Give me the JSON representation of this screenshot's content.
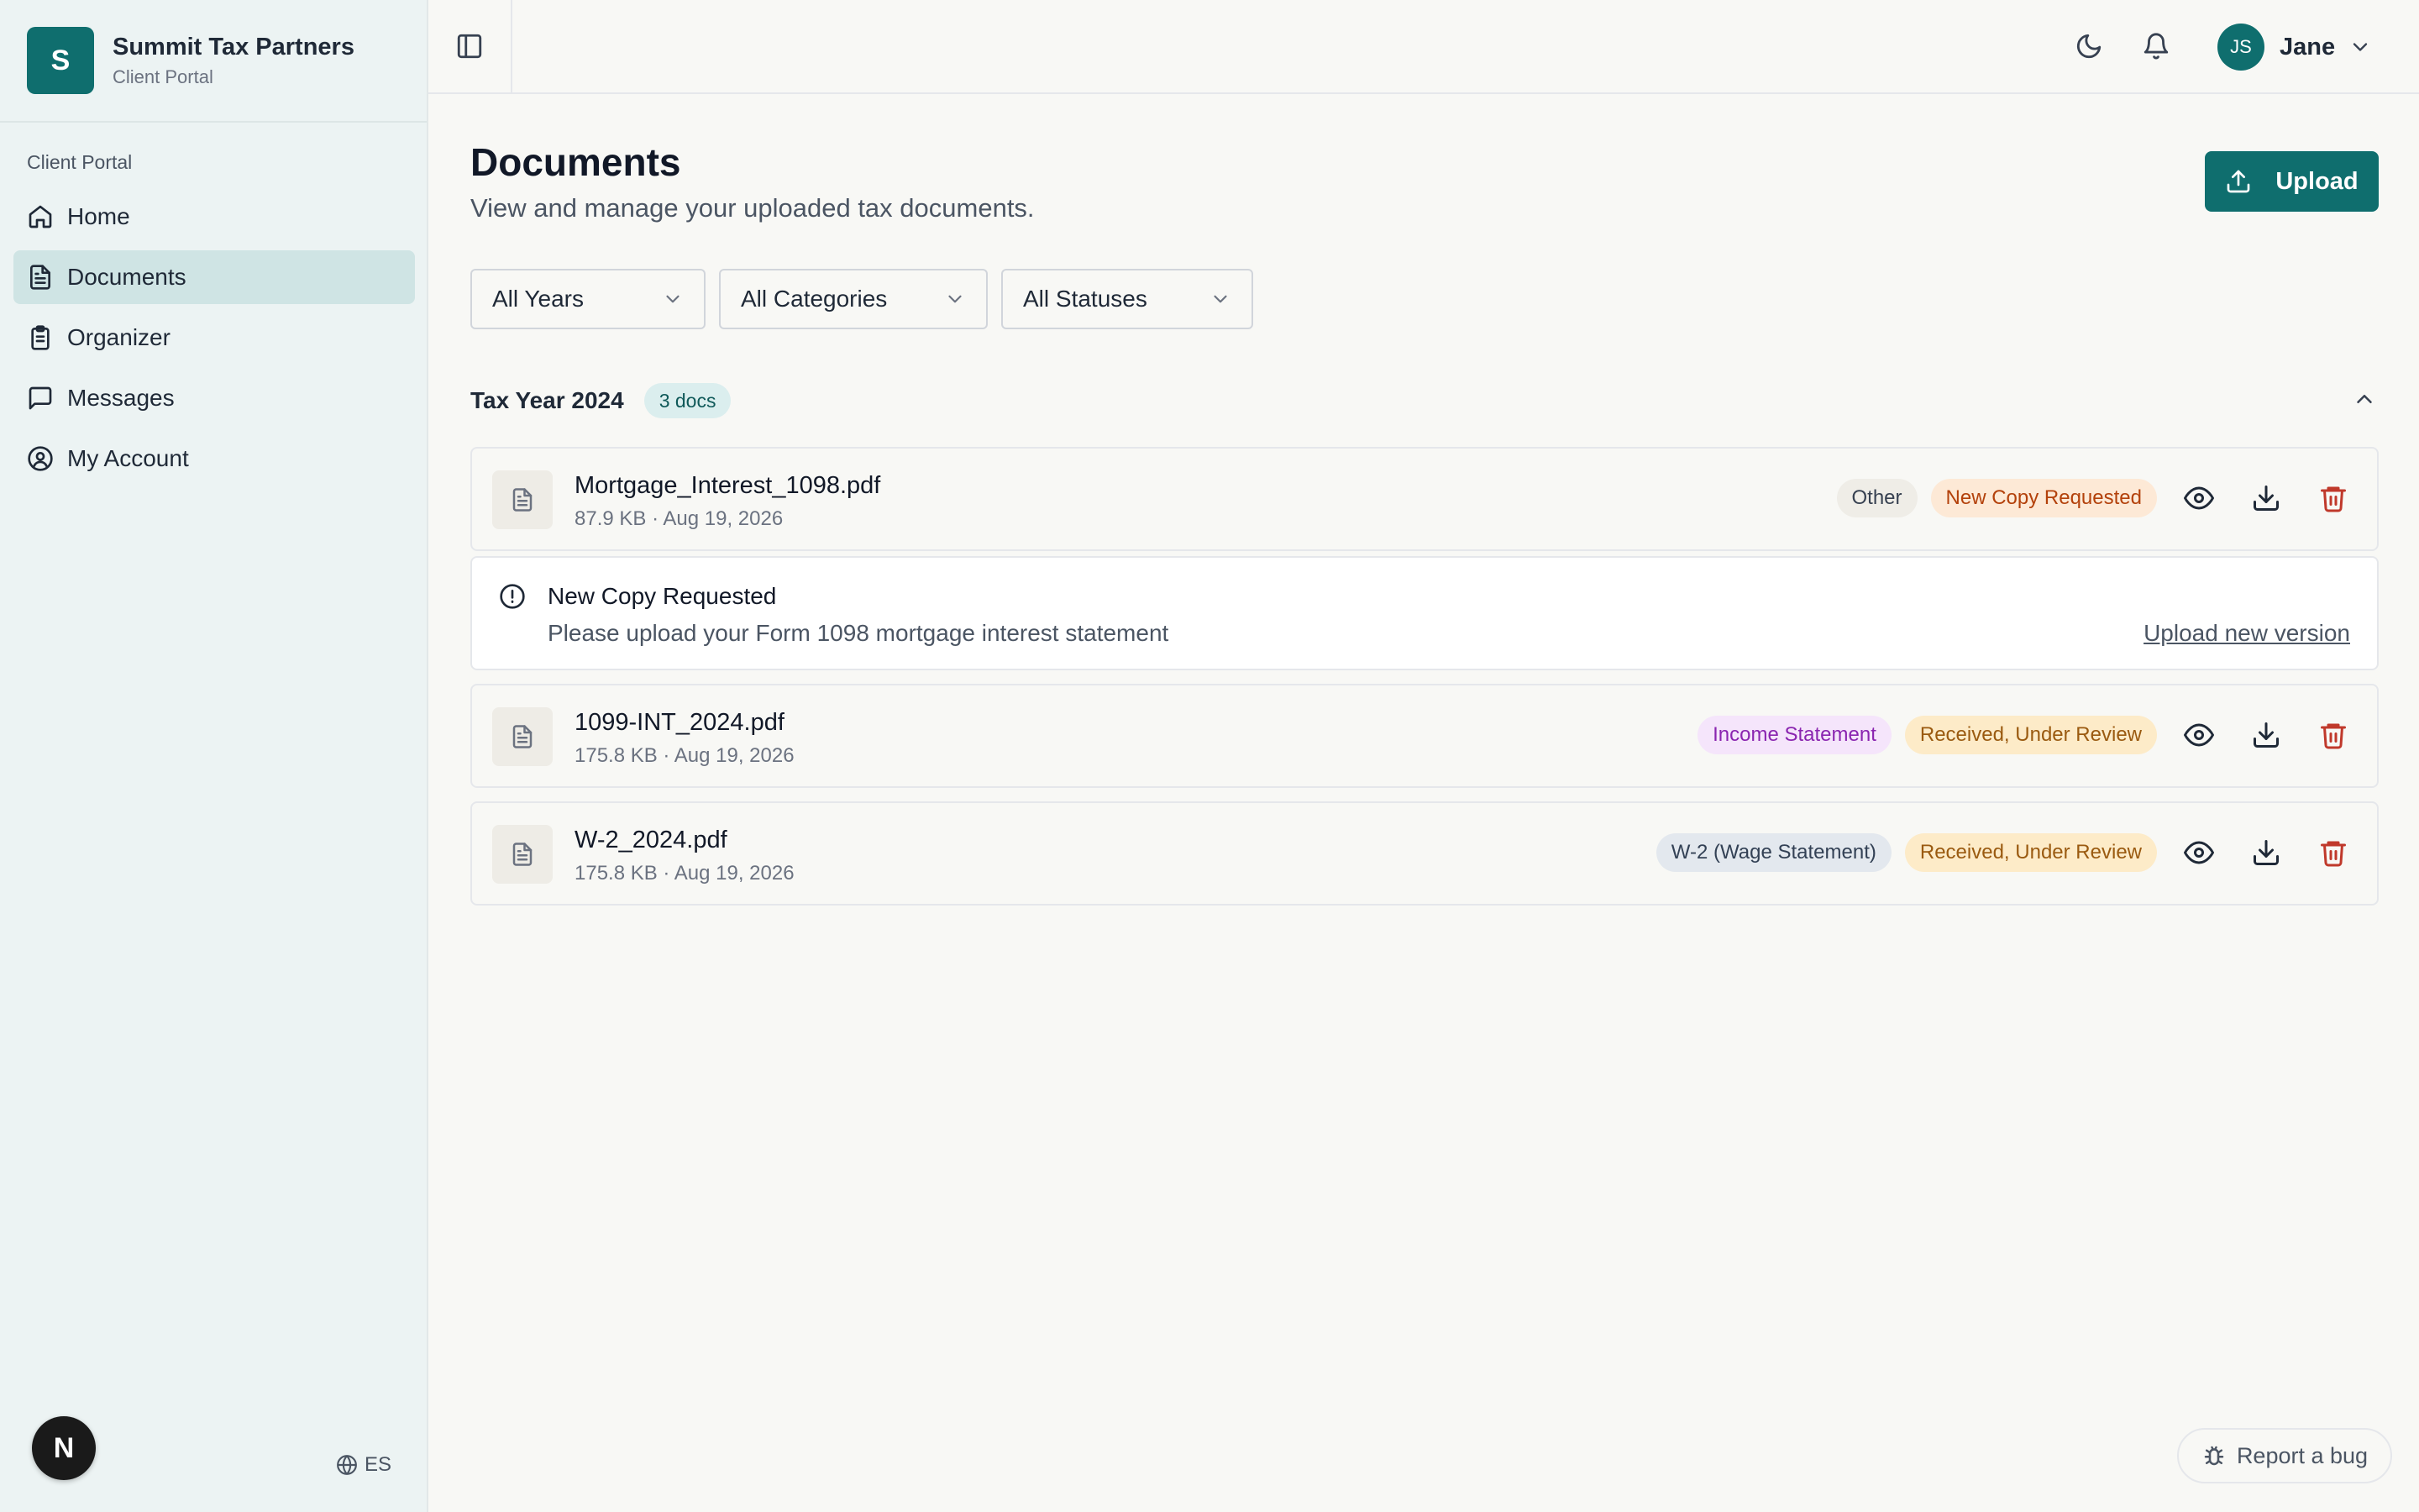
{
  "brand": {
    "logo_letter": "S",
    "name": "Summit Tax Partners",
    "subtitle": "Client Portal"
  },
  "sidebar": {
    "section_label": "Client Portal",
    "items": [
      {
        "label": "Home",
        "icon": "home-icon",
        "active": false
      },
      {
        "label": "Documents",
        "icon": "document-icon",
        "active": true
      },
      {
        "label": "Organizer",
        "icon": "clipboard-icon",
        "active": false
      },
      {
        "label": "Messages",
        "icon": "message-icon",
        "active": false
      },
      {
        "label": "My Account",
        "icon": "user-circle-icon",
        "active": false
      }
    ],
    "dev_badge": "N",
    "language": "ES"
  },
  "topbar": {
    "user_initials": "JS",
    "user_name": "Jane"
  },
  "page": {
    "title": "Documents",
    "subtitle": "View and manage your uploaded tax documents.",
    "upload_label": "Upload"
  },
  "filters": {
    "year": "All Years",
    "category": "All Categories",
    "status": "All Statuses"
  },
  "group": {
    "title": "Tax Year 2024",
    "count": "3 docs"
  },
  "documents": [
    {
      "name": "Mortgage_Interest_1098.pdf",
      "meta": "87.9 KB · Aug 19, 2026",
      "category": "Other",
      "status": "New Copy Requested"
    },
    {
      "name": "1099-INT_2024.pdf",
      "meta": "175.8 KB · Aug 19, 2026",
      "category": "Income Statement",
      "status": "Received, Under Review"
    },
    {
      "name": "W-2_2024.pdf",
      "meta": "175.8 KB · Aug 19, 2026",
      "category": "W-2 (Wage Statement)",
      "status": "Received, Under Review"
    }
  ],
  "notice": {
    "title": "New Copy Requested",
    "message": "Please upload your Form 1098 mortgage interest statement",
    "link": "Upload new version"
  },
  "report_bug": "Report a bug",
  "colors": {
    "accent": "#0f6e6e",
    "danger": "#c0392b"
  }
}
